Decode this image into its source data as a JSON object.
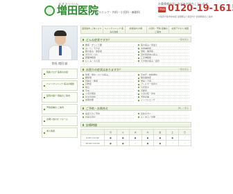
{
  "header": {
    "ruby": "ますだいいん",
    "name": "増田医院",
    "subtitle": "ペインクリニック・内科・小児科・麻酔科",
    "note": "お薬情報のないお方をお待ちしています",
    "tel_mark": "FREE",
    "tel": "0120-19-1615",
    "address": "大阪府大阪市中央区 最寄駅より徒歩5分 診療時間のご案内"
  },
  "nav": [
    "医院案内 ごあいさつ",
    "ペインクリニック 痛みの治療",
    "診療案内 内科",
    "小児科・予防 接種のご案内",
    "交通アクセス 地図"
  ],
  "sidebar": {
    "caption": "院長 増田 誠",
    "buttons": [
      "院長ブログ 医療のお話",
      "ペインクリニック 痛みの相談",
      "医院の紹介 施設のご案内",
      "予防接種の ご案内",
      "お問い合わせ フォーム",
      "求人情報"
    ]
  },
  "sections": [
    {
      "title": "どんな症状ですか？",
      "link": "一覧を見る",
      "items": [
        "腰痛・ぎっくり腰",
        "首の痛み・寝違え",
        "肩こり・五十肩",
        "坐骨神経痛",
        "膝の痛み・関節痛",
        "頭痛・偏頭痛",
        "手足のしびれ",
        "帯状疱疹後の痛み",
        "顔面神経痛",
        "三叉神経痛",
        "むくみ・冷え症",
        "その他の痛み・症状"
      ]
    },
    {
      "title": "お困りの症状はありますか？",
      "link": "一覧を見る",
      "items": [
        "風邪・発熱・のどの痛み",
        "高血圧・動脈硬化",
        "糖尿病",
        "脂質異常症",
        "胃腸炎・腹痛",
        "便秘・下痢",
        "花粉症",
        "アレルギー性鼻炎",
        "喘息",
        "気管支炎",
        "貧血",
        "不眠症",
        "小児の発熱",
        "小児の咳・鼻水",
        "乳幼児健診",
        "予防接種",
        "健康診断",
        "インフルエンザ"
      ]
    },
    {
      "title": "ご予約・お問合せ",
      "link": "詳しく見る",
      "items": [
        "電話でのご予約",
        "初診の方へ",
        "診察の流れ",
        "よくあるご質問"
      ]
    }
  ],
  "schedule": {
    "title": "診療時間",
    "head": [
      "",
      "月",
      "火",
      "水",
      "木",
      "金",
      "土",
      "日"
    ],
    "rows": [
      [
        "9:00〜12:00",
        "●",
        "●",
        "●",
        "●",
        "●",
        "●",
        "／"
      ],
      [
        "16:00〜19:00",
        "●",
        "●",
        "／",
        "●",
        "●",
        "／",
        "／"
      ]
    ]
  }
}
